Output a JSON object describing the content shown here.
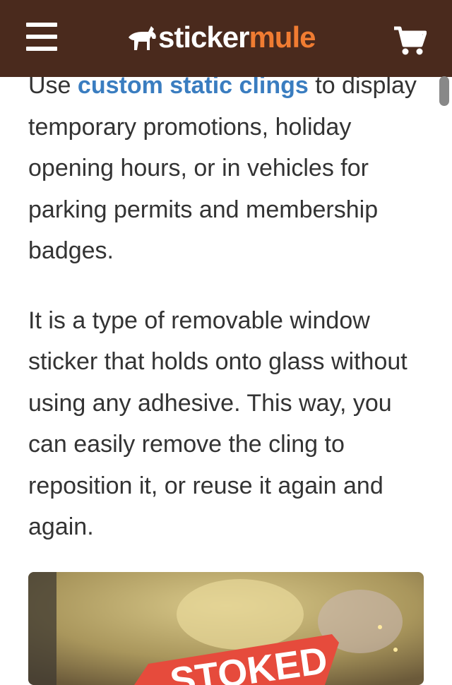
{
  "header": {
    "menu_icon": "hamburger-menu-icon",
    "logo_part1": "sticker",
    "logo_part2": "mule",
    "cart_icon": "shopping-cart-icon",
    "logo_colors": {
      "primary": "#ffffff",
      "accent": "#f07c32"
    },
    "background": "#4a2a1d"
  },
  "article": {
    "p1_prefix": "Use ",
    "p1_link": "custom static clings",
    "p1_rest": " to display temporary promotions, holiday opening hours, or in vehicles for parking permits and membership badges.",
    "p2": "It is a type of removable window sticker that holds onto glass without using any adhesive. This way, you can easily remove the cling to reposition it, or reuse it again and again.",
    "link_color": "#3a7dc0",
    "text_color": "#333333"
  },
  "image": {
    "sign_text": "STOKED"
  }
}
